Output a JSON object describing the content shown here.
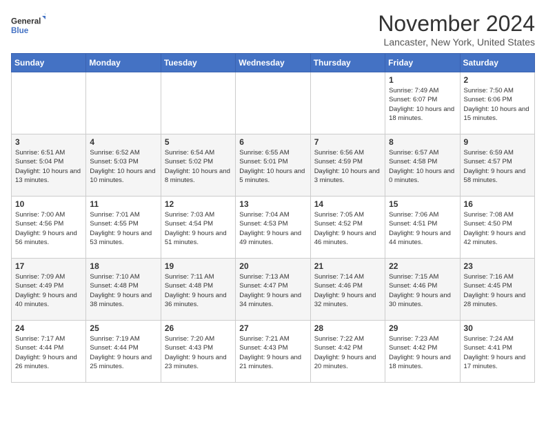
{
  "header": {
    "logo": {
      "general": "General",
      "blue": "Blue"
    },
    "title": "November 2024",
    "location": "Lancaster, New York, United States"
  },
  "weekdays": [
    "Sunday",
    "Monday",
    "Tuesday",
    "Wednesday",
    "Thursday",
    "Friday",
    "Saturday"
  ],
  "weeks": [
    [
      {
        "day": "",
        "info": ""
      },
      {
        "day": "",
        "info": ""
      },
      {
        "day": "",
        "info": ""
      },
      {
        "day": "",
        "info": ""
      },
      {
        "day": "",
        "info": ""
      },
      {
        "day": "1",
        "info": "Sunrise: 7:49 AM\nSunset: 6:07 PM\nDaylight: 10 hours\nand 18 minutes."
      },
      {
        "day": "2",
        "info": "Sunrise: 7:50 AM\nSunset: 6:06 PM\nDaylight: 10 hours\nand 15 minutes."
      }
    ],
    [
      {
        "day": "3",
        "info": "Sunrise: 6:51 AM\nSunset: 5:04 PM\nDaylight: 10 hours\nand 13 minutes."
      },
      {
        "day": "4",
        "info": "Sunrise: 6:52 AM\nSunset: 5:03 PM\nDaylight: 10 hours\nand 10 minutes."
      },
      {
        "day": "5",
        "info": "Sunrise: 6:54 AM\nSunset: 5:02 PM\nDaylight: 10 hours\nand 8 minutes."
      },
      {
        "day": "6",
        "info": "Sunrise: 6:55 AM\nSunset: 5:01 PM\nDaylight: 10 hours\nand 5 minutes."
      },
      {
        "day": "7",
        "info": "Sunrise: 6:56 AM\nSunset: 4:59 PM\nDaylight: 10 hours\nand 3 minutes."
      },
      {
        "day": "8",
        "info": "Sunrise: 6:57 AM\nSunset: 4:58 PM\nDaylight: 10 hours\nand 0 minutes."
      },
      {
        "day": "9",
        "info": "Sunrise: 6:59 AM\nSunset: 4:57 PM\nDaylight: 9 hours\nand 58 minutes."
      }
    ],
    [
      {
        "day": "10",
        "info": "Sunrise: 7:00 AM\nSunset: 4:56 PM\nDaylight: 9 hours\nand 56 minutes."
      },
      {
        "day": "11",
        "info": "Sunrise: 7:01 AM\nSunset: 4:55 PM\nDaylight: 9 hours\nand 53 minutes."
      },
      {
        "day": "12",
        "info": "Sunrise: 7:03 AM\nSunset: 4:54 PM\nDaylight: 9 hours\nand 51 minutes."
      },
      {
        "day": "13",
        "info": "Sunrise: 7:04 AM\nSunset: 4:53 PM\nDaylight: 9 hours\nand 49 minutes."
      },
      {
        "day": "14",
        "info": "Sunrise: 7:05 AM\nSunset: 4:52 PM\nDaylight: 9 hours\nand 46 minutes."
      },
      {
        "day": "15",
        "info": "Sunrise: 7:06 AM\nSunset: 4:51 PM\nDaylight: 9 hours\nand 44 minutes."
      },
      {
        "day": "16",
        "info": "Sunrise: 7:08 AM\nSunset: 4:50 PM\nDaylight: 9 hours\nand 42 minutes."
      }
    ],
    [
      {
        "day": "17",
        "info": "Sunrise: 7:09 AM\nSunset: 4:49 PM\nDaylight: 9 hours\nand 40 minutes."
      },
      {
        "day": "18",
        "info": "Sunrise: 7:10 AM\nSunset: 4:48 PM\nDaylight: 9 hours\nand 38 minutes."
      },
      {
        "day": "19",
        "info": "Sunrise: 7:11 AM\nSunset: 4:48 PM\nDaylight: 9 hours\nand 36 minutes."
      },
      {
        "day": "20",
        "info": "Sunrise: 7:13 AM\nSunset: 4:47 PM\nDaylight: 9 hours\nand 34 minutes."
      },
      {
        "day": "21",
        "info": "Sunrise: 7:14 AM\nSunset: 4:46 PM\nDaylight: 9 hours\nand 32 minutes."
      },
      {
        "day": "22",
        "info": "Sunrise: 7:15 AM\nSunset: 4:46 PM\nDaylight: 9 hours\nand 30 minutes."
      },
      {
        "day": "23",
        "info": "Sunrise: 7:16 AM\nSunset: 4:45 PM\nDaylight: 9 hours\nand 28 minutes."
      }
    ],
    [
      {
        "day": "24",
        "info": "Sunrise: 7:17 AM\nSunset: 4:44 PM\nDaylight: 9 hours\nand 26 minutes."
      },
      {
        "day": "25",
        "info": "Sunrise: 7:19 AM\nSunset: 4:44 PM\nDaylight: 9 hours\nand 25 minutes."
      },
      {
        "day": "26",
        "info": "Sunrise: 7:20 AM\nSunset: 4:43 PM\nDaylight: 9 hours\nand 23 minutes."
      },
      {
        "day": "27",
        "info": "Sunrise: 7:21 AM\nSunset: 4:43 PM\nDaylight: 9 hours\nand 21 minutes."
      },
      {
        "day": "28",
        "info": "Sunrise: 7:22 AM\nSunset: 4:42 PM\nDaylight: 9 hours\nand 20 minutes."
      },
      {
        "day": "29",
        "info": "Sunrise: 7:23 AM\nSunset: 4:42 PM\nDaylight: 9 hours\nand 18 minutes."
      },
      {
        "day": "30",
        "info": "Sunrise: 7:24 AM\nSunset: 4:41 PM\nDaylight: 9 hours\nand 17 minutes."
      }
    ]
  ]
}
